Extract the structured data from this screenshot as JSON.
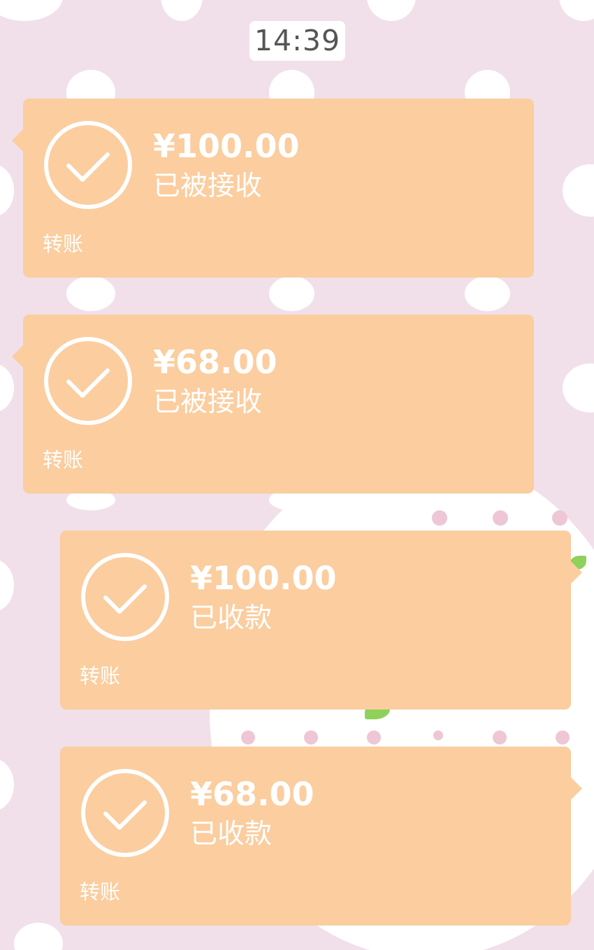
{
  "chat": {
    "timestamp": "14:39",
    "messages": [
      {
        "direction": "incoming",
        "amount": "¥100.00",
        "status": "已被接收",
        "type_label": "转账",
        "icon": "check-circle-icon"
      },
      {
        "direction": "incoming",
        "amount": "¥68.00",
        "status": "已被接收",
        "type_label": "转账",
        "icon": "check-circle-icon"
      },
      {
        "direction": "outgoing",
        "amount": "¥100.00",
        "status": "已收款",
        "type_label": "转账",
        "icon": "check-circle-icon"
      },
      {
        "direction": "outgoing",
        "amount": "¥68.00",
        "status": "已收款",
        "type_label": "转账",
        "icon": "check-circle-icon"
      }
    ]
  },
  "colors": {
    "background": "#f1e0ea",
    "card": "#fbcd9f",
    "card_text": "#ffffff",
    "time_pill": "#ffffff",
    "time_text": "#555555"
  }
}
